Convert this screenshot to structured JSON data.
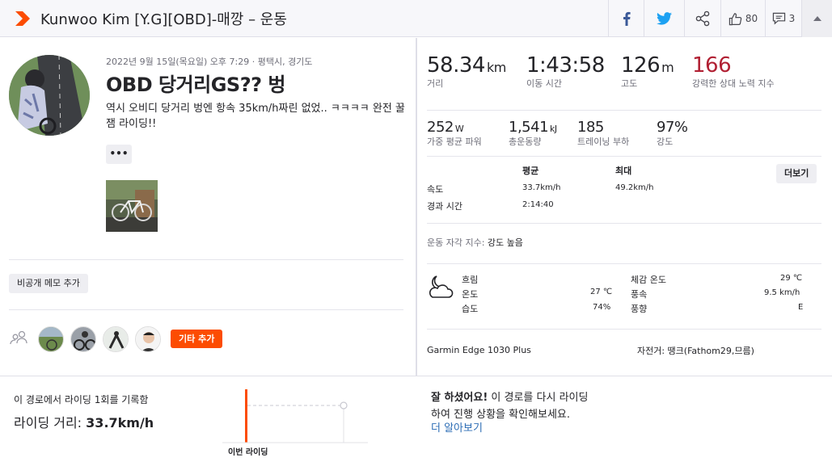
{
  "header": {
    "title": "Kunwoo Kim [Y.G][OBD]-매깡 – 운동",
    "kudos_count": "80",
    "comments_count": "3"
  },
  "activity": {
    "date": "2022년 9월 15일(목요일) 오후 7:29 · 평택시, 경기도",
    "name": "OBD 당거리GS?? 벙",
    "description": "역시 오비디 당거리 벙엔 항속 35km/h짜린 없었.. ㅋㅋㅋㅋ 완전 꿀잼 라이딩!!",
    "more_label": "•••",
    "private_note_label": "비공개 메모 추가",
    "add_others_label": "기타 추가"
  },
  "stats_main": [
    {
      "value": "58.34",
      "unit": "km",
      "label": "거리"
    },
    {
      "value": "1:43:58",
      "unit": "",
      "label": "이동 시간"
    },
    {
      "value": "126",
      "unit": "m",
      "label": "고도"
    },
    {
      "value": "166",
      "unit": "",
      "label": "강력한 상대 노력 지수"
    }
  ],
  "stats_secondary": [
    {
      "value": "252",
      "unit": "W",
      "label": "가중 평균 파워"
    },
    {
      "value": "1,541",
      "unit": "kJ",
      "label": "총운동량"
    },
    {
      "value": "185",
      "unit": "",
      "label": "트레이닝 부하"
    },
    {
      "value": "97%",
      "unit": "",
      "label": "강도"
    }
  ],
  "table": {
    "col_avg": "평균",
    "col_max": "최대",
    "more_button": "더보기",
    "rows": [
      {
        "label": "속도",
        "avg": "33.7km/h",
        "max": "49.2km/h"
      },
      {
        "label": "경과 시간",
        "avg": "2:14:40",
        "max": ""
      }
    ]
  },
  "perceived": {
    "label": "운동 자각 지수:",
    "value": "강도 높음"
  },
  "weather": {
    "condition": "흐림",
    "temp_label": "온도",
    "temp": "27 ℃",
    "humidity_label": "습도",
    "humidity": "74%",
    "feels_label": "체감 온도",
    "feels": "29 ℃",
    "wind_label": "풍속",
    "wind": "9.5 km/h",
    "dir_label": "풍향",
    "dir": "E"
  },
  "device": {
    "name": "Garmin Edge 1030 Plus",
    "bike": "자전거: 땡크(Fathom29,므름)"
  },
  "segment": {
    "record_text": "이 경로에서 라이딩 1회를 기록함",
    "distance_label": "라이딩 거리:",
    "distance_value": "33.7km/h",
    "chart_label": "이번 라이딩",
    "praise_bold": "잘 하셨어요!",
    "praise_rest": "이 경로를 다시 라이딩",
    "praise_line2": "하여 진행 상황을 확인해보세요.",
    "learn_more": "더 알아보기"
  },
  "colors": {
    "accent": "#fc4c02",
    "effort": "#b12033",
    "link": "#2d6db5"
  }
}
